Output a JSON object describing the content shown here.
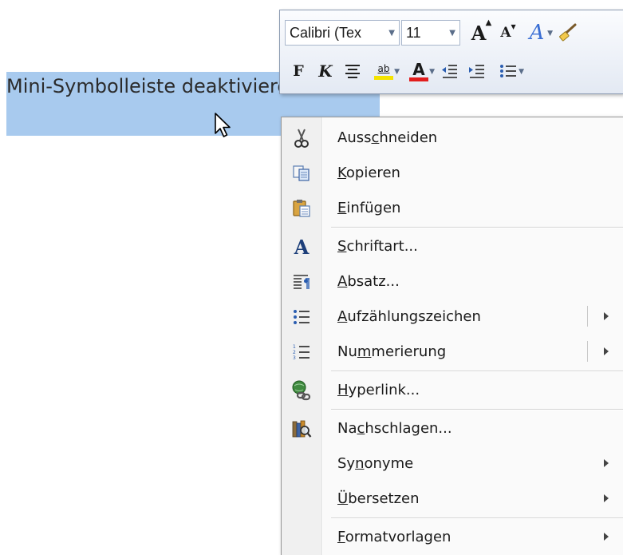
{
  "document": {
    "selected_text": "Mini-Symbolleiste deaktivieren"
  },
  "mini_toolbar": {
    "font_name": "Calibri (Tex",
    "font_size": "11",
    "row1_icons": [
      "grow-font-icon",
      "shrink-font-icon",
      "text-styles-icon",
      "format-painter-icon"
    ],
    "row2_icons": [
      "bold-icon",
      "italic-icon",
      "center-align-icon",
      "highlight-icon",
      "font-color-icon",
      "decrease-indent-icon",
      "increase-indent-icon",
      "bullets-icon"
    ],
    "grow_font_glyph": "A",
    "shrink_font_glyph": "A",
    "text_styles_glyph": "A",
    "bold_glyph": "F",
    "italic_glyph": "K",
    "highlight_glyph": "ab",
    "font_color_glyph": "A",
    "highlight_color": "#f4e300",
    "font_color": "#e21d1d"
  },
  "context_menu": {
    "items": [
      {
        "label_pre": "Auss",
        "accel": "c",
        "label_post": "hneiden",
        "icon": "scissors-icon"
      },
      {
        "label_pre": "",
        "accel": "K",
        "label_post": "opieren",
        "icon": "copy-icon"
      },
      {
        "label_pre": "",
        "accel": "E",
        "label_post": "infügen",
        "icon": "paste-icon"
      },
      {
        "label_pre": "",
        "accel": "S",
        "label_post": "chriftart...",
        "icon": "font-icon",
        "icon_glyph": "A"
      },
      {
        "label_pre": "",
        "accel": "A",
        "label_post": "bsatz...",
        "icon": "paragraph-icon"
      },
      {
        "label_pre": "",
        "accel": "A",
        "label_post": "ufzählungszeichen",
        "icon": "bullets-icon"
      },
      {
        "label_pre": "Nu",
        "accel": "m",
        "label_post": "merierung",
        "icon": "numbering-icon"
      },
      {
        "label_pre": "",
        "accel": "H",
        "label_post": "yperlink...",
        "icon": "hyperlink-icon"
      },
      {
        "label_pre": "Na",
        "accel": "c",
        "label_post": "hschlagen...",
        "icon": "research-icon"
      },
      {
        "label_pre": "Sy",
        "accel": "n",
        "label_post": "onyme",
        "icon": ""
      },
      {
        "label_pre": "",
        "accel": "Ü",
        "label_post": "bersetzen",
        "icon": ""
      },
      {
        "label_pre": "",
        "accel": "F",
        "label_post": "ormatvorlagen",
        "icon": ""
      }
    ]
  },
  "colors": {
    "selection": "#a8caee",
    "menu_gutter": "#f0f0f0"
  }
}
